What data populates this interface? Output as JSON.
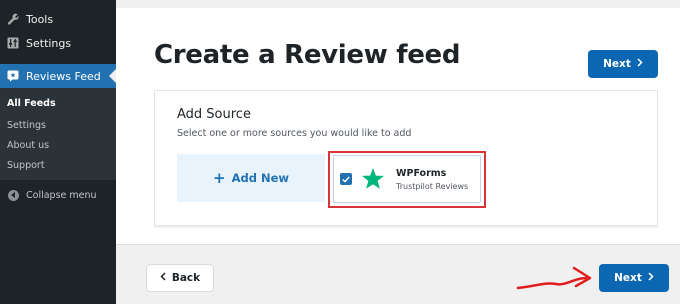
{
  "sidebar": {
    "tools_label": "Tools",
    "settings_label": "Settings",
    "plugin_label": "Reviews Feed",
    "submenu": [
      "All Feeds",
      "Settings",
      "About us",
      "Support"
    ],
    "collapse_label": "Collapse menu"
  },
  "main": {
    "title": "Create a Review feed",
    "next_label": "Next",
    "back_label": "Back",
    "add_source": {
      "title": "Add Source",
      "subtitle": "Select one or more sources you would like to add",
      "add_new_label": "Add New"
    },
    "sources": [
      {
        "name": "WPForms",
        "subtitle": "Trustpilot Reviews",
        "checked": true
      }
    ]
  },
  "colors": {
    "accent": "#0b67b1",
    "sidebar": "#1d2327",
    "highlight": "#d63638",
    "trustpilot_star": "#00b67a"
  }
}
